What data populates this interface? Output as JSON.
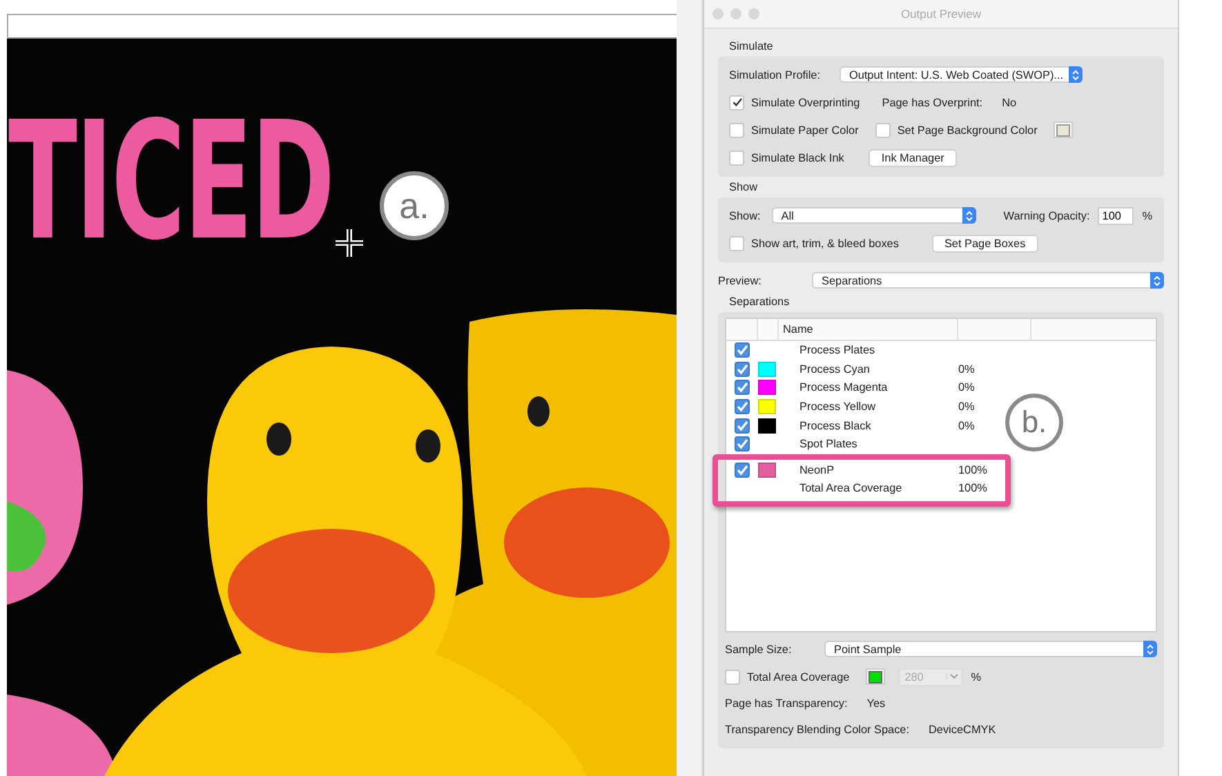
{
  "document": {
    "headline": "TICED"
  },
  "callouts": [
    {
      "label": "a."
    },
    {
      "label": "b."
    }
  ],
  "window": {
    "title": "Output Preview"
  },
  "simulate": {
    "label": "Simulate",
    "profile_label": "Simulation Profile:",
    "profile_value": "Output Intent: U.S. Web Coated (SWOP)...",
    "rows": [
      [
        {
          "kind": "checkbox",
          "label": "Simulate Overprinting",
          "checked": true
        },
        {
          "kind": "info",
          "label": "Page has Overprint:",
          "value": "No"
        }
      ],
      [
        {
          "kind": "checkbox",
          "label": "Simulate Paper Color",
          "checked": false
        },
        {
          "kind": "checkbox",
          "label": "Set Page Background Color",
          "checked": false
        },
        {
          "kind": "swatch",
          "color": "#e8e6d4"
        }
      ],
      [
        {
          "kind": "checkbox",
          "label": "Simulate Black Ink",
          "checked": false
        },
        {
          "kind": "button",
          "label": "Ink Manager"
        }
      ]
    ]
  },
  "show": {
    "label": "Show",
    "show_label": "Show:",
    "show_value": "All",
    "opacity_label": "Warning Opacity:",
    "opacity_value": "100",
    "opacity_unit": "%",
    "boxes_label": "Show art, trim, & bleed boxes",
    "boxes_checked": false,
    "button": "Set Page Boxes"
  },
  "preview": {
    "label": "Preview:",
    "value": "Separations"
  },
  "separations": {
    "label": "Separations",
    "columns": [
      "Name"
    ],
    "rows": [
      {
        "kind": "group",
        "checked": true,
        "name": "Process Plates",
        "highlighted": false
      },
      {
        "kind": "plate",
        "checked": true,
        "color": "#00ffff",
        "name": "Process Cyan",
        "value": "0%",
        "highlighted": false
      },
      {
        "kind": "plate",
        "checked": true,
        "color": "#ff00ff",
        "name": "Process Magenta",
        "value": "0%",
        "highlighted": false
      },
      {
        "kind": "plate",
        "checked": true,
        "color": "#ffff00",
        "name": "Process Yellow",
        "value": "0%",
        "highlighted": false
      },
      {
        "kind": "plate",
        "checked": true,
        "color": "#000000",
        "name": "Process Black",
        "value": "0%",
        "highlighted": false
      },
      {
        "kind": "group",
        "checked": true,
        "name": "Spot Plates",
        "highlighted": false
      },
      {
        "kind": "plate",
        "checked": true,
        "color": "#e060a0",
        "name": "NeonP",
        "value": "100%",
        "highlighted": true
      },
      {
        "kind": "total",
        "name": "Total Area Coverage",
        "value": "100%",
        "highlighted": true
      }
    ]
  },
  "sample": {
    "label": "Sample Size:",
    "value": "Point Sample"
  },
  "coverage": {
    "label": "Total Area Coverage",
    "checked": false,
    "color": "#00e000",
    "value": "280",
    "disabled": true,
    "unit": "%"
  },
  "info": [
    {
      "label": "Page has Transparency:",
      "value": "Yes"
    },
    {
      "label": "Transparency Blending Color Space:",
      "value": "DeviceCMYK"
    }
  ]
}
